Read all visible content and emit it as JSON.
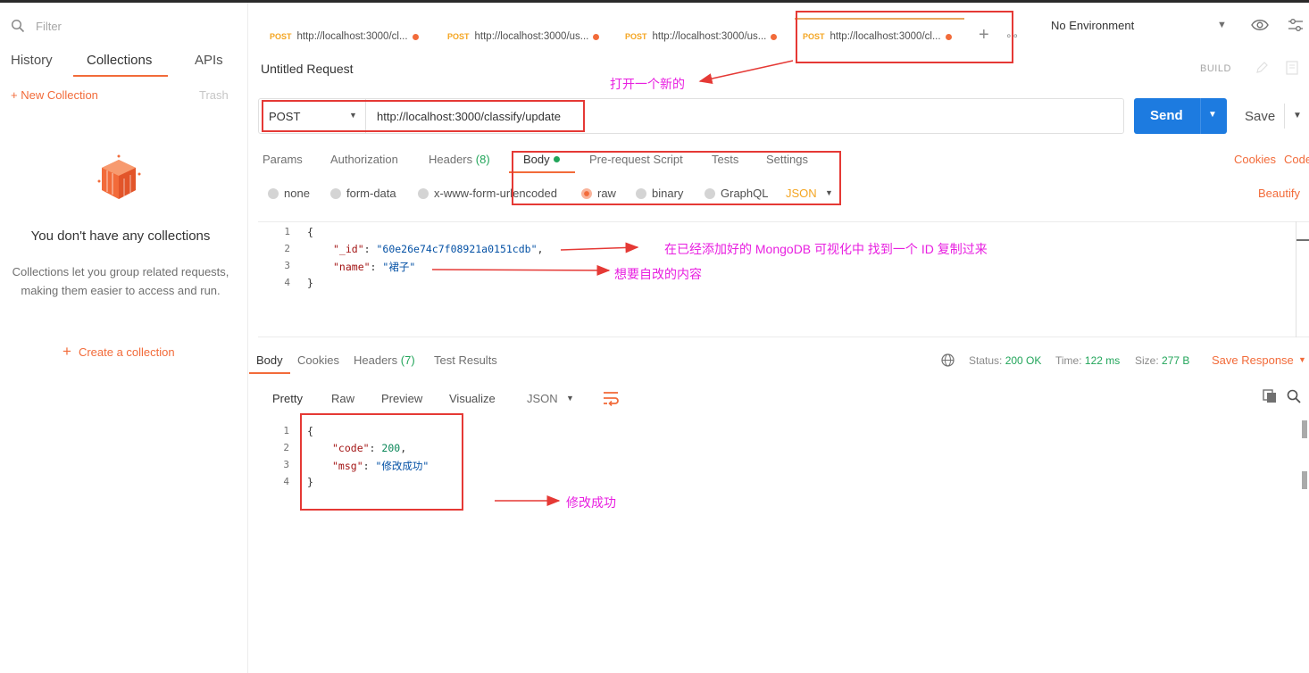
{
  "sidebar": {
    "filter_placeholder": "Filter",
    "tabs": [
      "History",
      "Collections",
      "APIs"
    ],
    "new_collection": "+ New Collection",
    "trash": "Trash",
    "empty_title": "You don't have any collections",
    "empty_desc": "Collections let you group related requests, making them easier to access and run.",
    "create_collection": "Create a collection"
  },
  "request_tabs": [
    {
      "method": "POST",
      "url": "http://localhost:3000/cl..."
    },
    {
      "method": "POST",
      "url": "http://localhost:3000/us..."
    },
    {
      "method": "POST",
      "url": "http://localhost:3000/us..."
    },
    {
      "method": "POST",
      "url": "http://localhost:3000/cl..."
    }
  ],
  "environment": "No Environment",
  "request": {
    "title": "Untitled Request",
    "build": "BUILD",
    "method": "POST",
    "url": "http://localhost:3000/classify/update",
    "send": "Send",
    "save": "Save"
  },
  "request_subtabs": {
    "params": "Params",
    "authorization": "Authorization",
    "headers": "Headers",
    "headers_count": "(8)",
    "body": "Body",
    "prerequest": "Pre-request Script",
    "tests": "Tests",
    "settings": "Settings",
    "cookies": "Cookies",
    "code": "Code"
  },
  "body_modes": {
    "none": "none",
    "form_data": "form-data",
    "urlencoded": "x-www-form-urlencoded",
    "raw": "raw",
    "binary": "binary",
    "graphql": "GraphQL",
    "json": "JSON",
    "beautify": "Beautify"
  },
  "request_body": {
    "line_numbers": [
      "1",
      "2",
      "3",
      "4"
    ],
    "open": "{",
    "id_key": "\"_id\"",
    "id_value": "\"60e26e74c7f08921a0151cdb\"",
    "name_key": "\"name\"",
    "name_value": "\"裙子\"",
    "close": "}"
  },
  "response": {
    "tabs": {
      "body": "Body",
      "cookies": "Cookies",
      "headers": "Headers",
      "headers_count": "(7)",
      "test_results": "Test Results"
    },
    "status_label": "Status:",
    "status_value": "200 OK",
    "time_label": "Time:",
    "time_value": "122 ms",
    "size_label": "Size:",
    "size_value": "277 B",
    "save_response": "Save Response",
    "formats": {
      "pretty": "Pretty",
      "raw": "Raw",
      "preview": "Preview",
      "visualize": "Visualize",
      "json": "JSON"
    },
    "body": {
      "line_numbers": [
        "1",
        "2",
        "3",
        "4"
      ],
      "open": "{",
      "code_key": "\"code\"",
      "code_value": "200",
      "msg_key": "\"msg\"",
      "msg_value": "\"修改成功\"",
      "close": "}"
    }
  },
  "annotations": {
    "open_new": "打开一个新的",
    "copy_id": "在已经添加好的  MongoDB 可视化中 找到一个 ID 复制过来",
    "content": "想要自改的内容",
    "success": "修改成功"
  },
  "colors": {
    "accent": "#f26b3a",
    "send": "#1d7be0",
    "annotation": "#e81fe0",
    "box": "#e53935",
    "success": "#22a55a"
  }
}
